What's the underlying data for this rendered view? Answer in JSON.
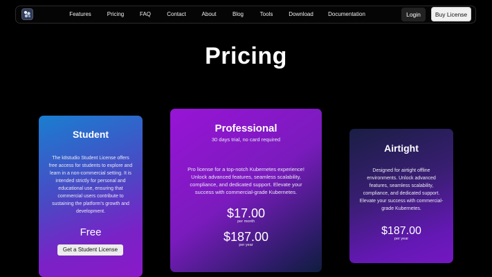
{
  "nav": {
    "logo_icon": "k8studio-logo-icon",
    "links": [
      "Features",
      "Pricing",
      "FAQ",
      "Contact",
      "About",
      "Blog",
      "Tools",
      "Download",
      "Documentation"
    ],
    "login_label": "Login",
    "buy_label": "Buy License"
  },
  "page_title": "Pricing",
  "cards": {
    "student": {
      "title": "Student",
      "description": "The k8studio Student License offers free access for students to explore and learn in a non-commercial setting. It is intended strictly for personal and educational use, ensuring that commercial users contribute to sustaining the platform's growth and development.",
      "price": "Free",
      "button_label": "Get a Student License"
    },
    "pro": {
      "title": "Professional",
      "subtitle": "30 days trial, no card required",
      "description": "Pro license for a top-notch Kubernetes experience! Unlock advanced features, seamless scalability, compliance, and dedicated support. Elevate your success with commercial-grade Kubernetes.",
      "price_month": "$17.00",
      "per_month": "per month",
      "price_year": "$187.00",
      "per_year": "per year"
    },
    "airtight": {
      "title": "Airtight",
      "description": "Designed for airtight offline environments. Unlock advanced features, seamless scalability, compliance, and dedicated support. Elevate your success with commercial-grade Kubernetes.",
      "price_year": "$187.00",
      "per_year": "per year"
    }
  }
}
